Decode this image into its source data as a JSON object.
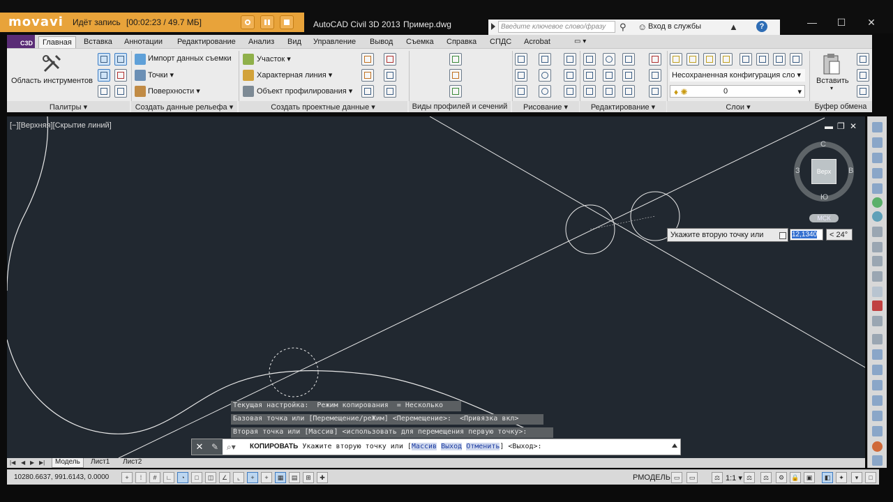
{
  "recorder": {
    "logo": "movavi",
    "status": "Идёт запись",
    "time": "[00:02:23 / 49.7 МБ]"
  },
  "window": {
    "app_title": "AutoCAD Civil 3D 2013",
    "file_name": "Пример.dwg",
    "search_placeholder": "Введите ключевое слово/фразу",
    "login": "Вход в службы",
    "help": "?"
  },
  "tabs": [
    "Главная",
    "Вставка",
    "Аннотации",
    "Редактирование",
    "Анализ",
    "Вид",
    "Управление",
    "Вывод",
    "Съемка",
    "Справка",
    "СПДС",
    "Acrobat"
  ],
  "active_tab": "Главная",
  "ribbon": {
    "tool_palettes_label": "Область инструментов",
    "import_survey": "Импорт данных съемки",
    "points": "Точки",
    "surfaces": "Поверхности",
    "parcel": "Участок",
    "feature_line": "Характерная линия",
    "grading": "Объект профилирования",
    "layer_state": "Несохраненная конфигурация сло",
    "layer_current": "0",
    "paste_label": "Вставить",
    "panels": {
      "palettes": "Палитры",
      "create_ground": "Создать данные рельефа",
      "create_design": "Создать проектные данные",
      "profile_views": "Виды профилей и сечений",
      "draw": "Рисование",
      "modify": "Редактирование",
      "layers": "Слои",
      "clipboard": "Буфер обмена"
    }
  },
  "viewport": {
    "label": "[−][Верхняя][Скрытие линий]",
    "viewcube_face": "Верх",
    "north": "С",
    "south": "Ю",
    "east": "В",
    "west": "З",
    "ucs": "МСК"
  },
  "dynamic_input": {
    "prompt": "Укажите вторую точку или",
    "length": "12,1340",
    "angle": "< 24°"
  },
  "history": [
    "Текущая настройка:  Режим копирования  = Несколько",
    "Базовая точка или [Перемещение/реЖим] <Перемещение>:  <Привязка вкл>",
    "Вторая точка или [Массив] <использовать для перемещения первую точку>:"
  ],
  "command": {
    "name": "КОПИРОВАТЬ",
    "prompt": "Укажите вторую точку или [",
    "options": [
      "Массив",
      "Выход",
      "Отменить"
    ],
    "suffix": "] <Выход>:"
  },
  "layout_tabs": [
    "Модель",
    "Лист1",
    "Лист2"
  ],
  "status": {
    "coords": "10280.6637, 991.6143, 0.0000",
    "model": "РМОДЕЛЬ",
    "scale": "1:1"
  }
}
